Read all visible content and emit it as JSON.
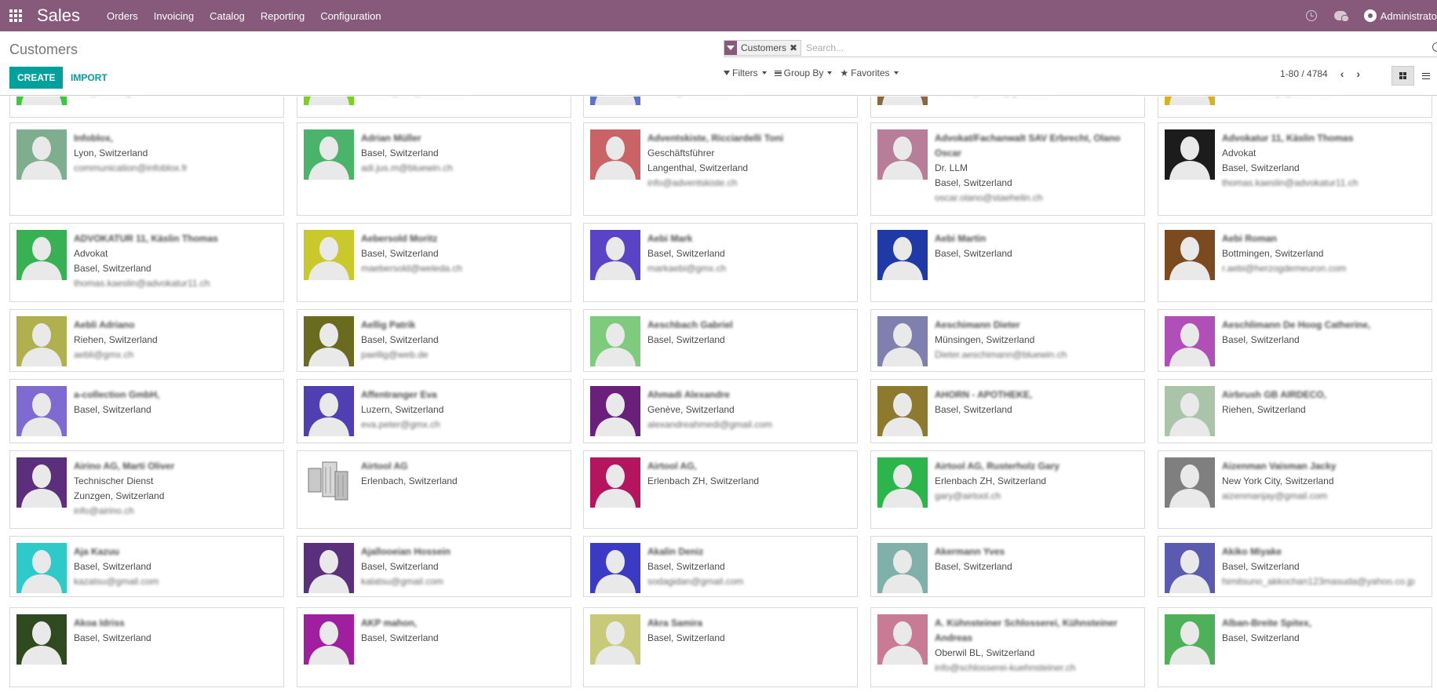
{
  "navbar": {
    "app_title": "Sales",
    "menu": [
      "Orders",
      "Invoicing",
      "Catalog",
      "Reporting",
      "Configuration"
    ],
    "user_name": "Administrato"
  },
  "control": {
    "title": "Customers",
    "create_label": "CREATE",
    "import_label": "IMPORT",
    "facet_label": "Customers",
    "search_placeholder": "Search...",
    "filters_label": "Filters",
    "groupby_label": "Group By",
    "favorites_label": "Favorites",
    "pager_value": "1-80 / 4784"
  },
  "partial_row": [
    {
      "color": "#3cc73c",
      "email": "info@ruckling.ch"
    },
    {
      "color": "#7ad11f",
      "email": "actions@unt@bluewin.ch"
    },
    {
      "color": "#5b75c6",
      "email": "bianco@hotmail.com"
    },
    {
      "color": "#8a6a3d",
      "email": "ammann@wettli@gmail.com"
    },
    {
      "color": "#dab21f",
      "email": "umberto.hinojo@adcom.ch"
    }
  ],
  "rows": [
    [
      {
        "color": "#7fae8e",
        "name": "Infoblox,",
        "lines": [
          "Lyon, Switzerland"
        ],
        "email": "communication@infoblox.fr"
      },
      {
        "color": "#4ab56a",
        "name": "Adrian Müller",
        "lines": [
          "Basel, Switzerland"
        ],
        "email": "adi.jus.m@bluewin.ch"
      },
      {
        "color": "#c96366",
        "name": "Adventskiste, Ricciardelli Toni",
        "lines": [
          "Geschäftsführer",
          "Langenthal, Switzerland"
        ],
        "email": "info@adventskiste.ch"
      },
      {
        "color": "#b77d99",
        "name": "Advokat/Fachanwalt SAV Erbrecht, Olano Oscar",
        "lines": [
          "Dr. LLM",
          "Basel, Switzerland"
        ],
        "email": "oscar.olano@staehelin.ch"
      },
      {
        "color": "#1c1c1c",
        "name": "Advokatur 11, Käslin Thomas",
        "lines": [
          "Advokat",
          "Basel, Switzerland"
        ],
        "email": "thomas.kaeslin@advokatur11.ch"
      }
    ],
    [
      {
        "color": "#38b154",
        "name": "ADVOKATUR 11, Käslin Thomas",
        "lines": [
          "Advokat",
          "Basel, Switzerland"
        ],
        "email": "thomas.kaeslin@advokatur11.ch"
      },
      {
        "color": "#c9c92c",
        "name": "Aebersold Moritz",
        "lines": [
          "Basel, Switzerland"
        ],
        "email": "maebersold@weleda.ch"
      },
      {
        "color": "#5a43c4",
        "name": "Aebi Mark",
        "lines": [
          "Basel, Switzerland"
        ],
        "email": "markaebi@gmx.ch"
      },
      {
        "color": "#1f3aa6",
        "name": "Aebi Martin",
        "lines": [
          "Basel, Switzerland"
        ],
        "email": ""
      },
      {
        "color": "#7b4a1f",
        "name": "Aebi Roman",
        "lines": [
          "Bottmingen, Switzerland"
        ],
        "email": "r.aebi@herzogdemeuron.com"
      }
    ],
    [
      {
        "color": "#b0b04f",
        "name": "Aebli Adriano",
        "lines": [
          "Riehen, Switzerland"
        ],
        "email": "aebli@gmx.ch"
      },
      {
        "color": "#6b6b1f",
        "name": "Aellig Patrik",
        "lines": [
          "Basel, Switzerland"
        ],
        "email": "paellig@web.de"
      },
      {
        "color": "#7ecb7e",
        "name": "Aeschbach Gabriel",
        "lines": [
          "Basel, Switzerland"
        ],
        "email": ""
      },
      {
        "color": "#7f7fb0",
        "name": "Aeschimann Dieter",
        "lines": [
          "Münsingen, Switzerland"
        ],
        "email": "Dieter.aeschimann@bluewin.ch"
      },
      {
        "color": "#b04fb8",
        "name": "Aeschlimann De Hoog Catherine,",
        "lines": [
          "Basel, Switzerland"
        ],
        "email": ""
      }
    ],
    [
      {
        "color": "#7f6ad1",
        "name": "a-collection GmbH,",
        "lines": [
          "Basel, Switzerland"
        ],
        "email": ""
      },
      {
        "color": "#4f3fb3",
        "name": "Affentranger Eva",
        "lines": [
          "Luzern, Switzerland"
        ],
        "email": "eva.peter@gmx.ch"
      },
      {
        "color": "#6a1f7b",
        "name": "Ahmadi Alexandre",
        "lines": [
          "Genève, Switzerland"
        ],
        "email": "alexandreahmedi@gmail.com"
      },
      {
        "color": "#8e7a2f",
        "name": "AHORN - APOTHEKE,",
        "lines": [
          "Basel, Switzerland"
        ],
        "email": ""
      },
      {
        "color": "#a9c4a9",
        "name": "Airbrush GB AIRDECO,",
        "lines": [
          "Riehen, Switzerland"
        ],
        "email": ""
      }
    ],
    [
      {
        "color": "#5b2f7b",
        "name": "Airino AG, Marti Oliver",
        "lines": [
          "Technischer Dienst",
          "Zunzgen, Switzerland"
        ],
        "email": "info@airino.ch"
      },
      {
        "color": "none",
        "name": "Airtool AG",
        "lines": [
          "Erlenbach, Switzerland"
        ],
        "email": ""
      },
      {
        "color": "#b5155f",
        "name": "Airtool AG,",
        "lines": [
          "Erlenbach ZH, Switzerland"
        ],
        "email": ""
      },
      {
        "color": "#2bb54b",
        "name": "Airtool AG, Rusterholz Gary",
        "lines": [
          "Erlenbach ZH, Switzerland"
        ],
        "email": "gary@airtool.ch"
      },
      {
        "color": "#7f7f7f",
        "name": "Aizenman Vaisman Jacky",
        "lines": [
          "New York City, Switzerland"
        ],
        "email": "aizenmanjay@gmail.com"
      }
    ],
    [
      {
        "color": "#2ec9c9",
        "name": "Aja Kazuu",
        "lines": [
          "Basel, Switzerland"
        ],
        "email": "kazatsu@gmail.com"
      },
      {
        "color": "#5a2f7b",
        "name": "Ajallooeian Hossein",
        "lines": [
          "Basel, Switzerland"
        ],
        "email": "kalatsu@gmail.com"
      },
      {
        "color": "#3a3ac4",
        "name": "Akalin Deniz",
        "lines": [
          "Basel, Switzerland"
        ],
        "email": "sodagidan@gmail.com"
      },
      {
        "color": "#7fb0a9",
        "name": "Akermann Yves",
        "lines": [
          "Basel, Switzerland"
        ],
        "email": ""
      },
      {
        "color": "#5a5ab0",
        "name": "Akiko Miyake",
        "lines": [
          "Basel, Switzerland"
        ],
        "email": "himitsuno_akkochan123masuda@yahoo.co.jp"
      }
    ],
    [
      {
        "color": "#2f4a1f",
        "name": "Akoa Idriss",
        "lines": [
          "Basel, Switzerland"
        ],
        "email": ""
      },
      {
        "color": "#a01fa0",
        "name": "AKP mahon,",
        "lines": [
          "Basel, Switzerland"
        ],
        "email": ""
      },
      {
        "color": "#c9c97a",
        "name": "Akra Samira",
        "lines": [
          "Basel, Switzerland"
        ],
        "email": ""
      },
      {
        "color": "#c97a94",
        "name": "A. Kühnsteiner Schlosserei, Kühnsteiner Andreas",
        "lines": [
          "Oberwil BL, Switzerland"
        ],
        "email": "info@schlosserei-kuehnsteiner.ch"
      },
      {
        "color": "#4fb05a",
        "name": "Alban-Breite Spitex,",
        "lines": [
          "Basel, Switzerland"
        ],
        "email": ""
      }
    ]
  ]
}
